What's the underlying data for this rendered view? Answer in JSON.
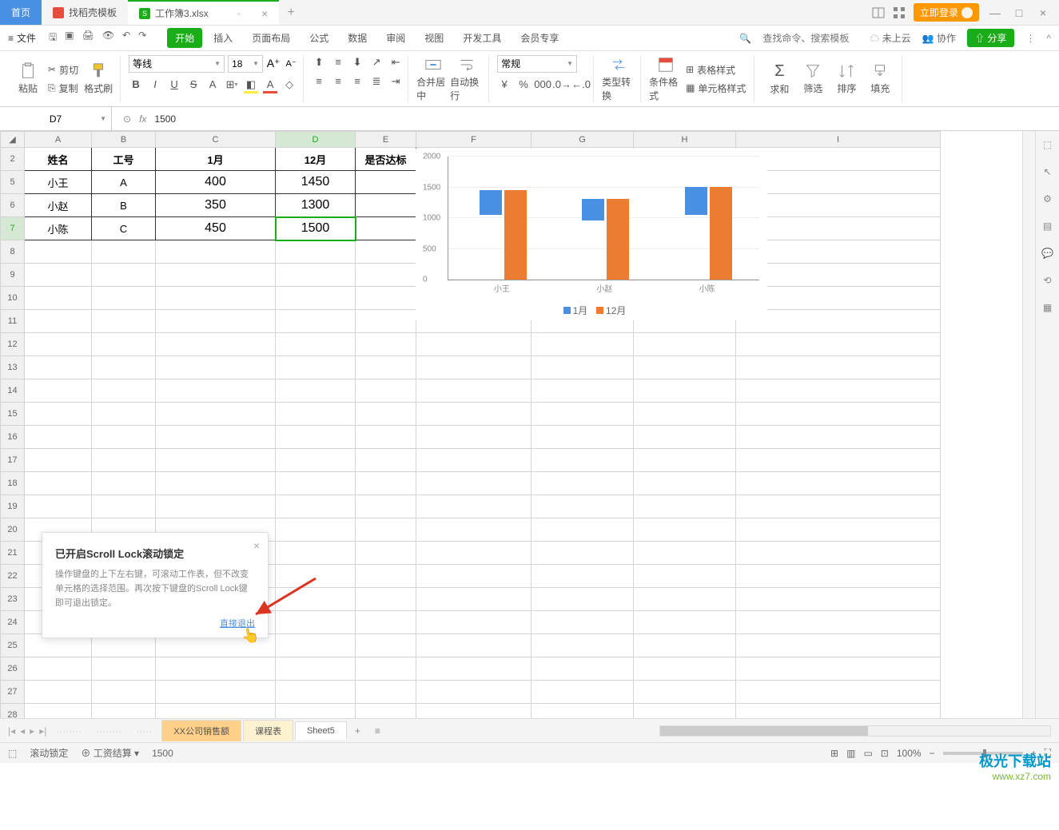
{
  "titlebar": {
    "home": "首页",
    "template_tab": "找稻壳模板",
    "doc_tab": "工作簿3.xlsx",
    "login": "立即登录"
  },
  "menubar": {
    "file": "文件",
    "tabs": [
      "开始",
      "插入",
      "页面布局",
      "公式",
      "数据",
      "审阅",
      "视图",
      "开发工具",
      "会员专享"
    ],
    "search_placeholder": "查找命令、搜索模板",
    "cloud": "未上云",
    "collab": "协作",
    "share": "分享"
  },
  "ribbon": {
    "paste": "粘贴",
    "cut": "剪切",
    "copy": "复制",
    "format_painter": "格式刷",
    "font": "等线",
    "font_size": "18",
    "merge": "合并居中",
    "wrap": "自动换行",
    "number_format": "常规",
    "type_convert": "类型转换",
    "cond_fmt": "条件格式",
    "table_style": "表格样式",
    "cell_style": "单元格样式",
    "sum": "求和",
    "filter": "筛选",
    "sort": "排序",
    "fill": "填充"
  },
  "namebox": {
    "cell": "D7",
    "formula": "1500"
  },
  "columns": [
    "A",
    "B",
    "C",
    "D",
    "E",
    "F",
    "G",
    "H",
    "I"
  ],
  "rows": [
    "2",
    "5",
    "6",
    "7",
    "8",
    "9",
    "10",
    "11",
    "12",
    "13",
    "14",
    "15",
    "16",
    "17",
    "18",
    "19",
    "20",
    "21",
    "22",
    "23"
  ],
  "table": {
    "headers": [
      "姓名",
      "工号",
      "1月",
      "12月",
      "是否达标"
    ],
    "data": [
      [
        "小王",
        "A",
        "400",
        "1450",
        ""
      ],
      [
        "小赵",
        "B",
        "350",
        "1300",
        ""
      ],
      [
        "小陈",
        "C",
        "450",
        "1500",
        ""
      ]
    ]
  },
  "chart_data": {
    "type": "bar",
    "categories": [
      "小王",
      "小赵",
      "小陈"
    ],
    "series": [
      {
        "name": "1月",
        "values": [
          400,
          350,
          450
        ],
        "color": "#4a90e2"
      },
      {
        "name": "12月",
        "values": [
          1450,
          1300,
          1500
        ],
        "color": "#ec7c30"
      }
    ],
    "ylim": [
      0,
      2000
    ],
    "yticks": [
      0,
      500,
      1000,
      1500,
      2000
    ]
  },
  "popup": {
    "title": "已开启Scroll Lock滚动锁定",
    "text": "操作键盘的上下左右键，可滚动工作表，但不改变单元格的选择范围。再次按下键盘的Scroll Lock键即可退出锁定。",
    "link": "直接退出"
  },
  "sheet_tabs": {
    "hidden_partial": "XX公司销售额",
    "tabs": [
      "课程表",
      "Sheet5"
    ]
  },
  "statusbar": {
    "scroll_lock": "滚动锁定",
    "calc": "工资结算",
    "value": "1500",
    "zoom": "100%"
  },
  "watermark": {
    "logo": "极光下载站",
    "url": "www.xz7.com"
  }
}
